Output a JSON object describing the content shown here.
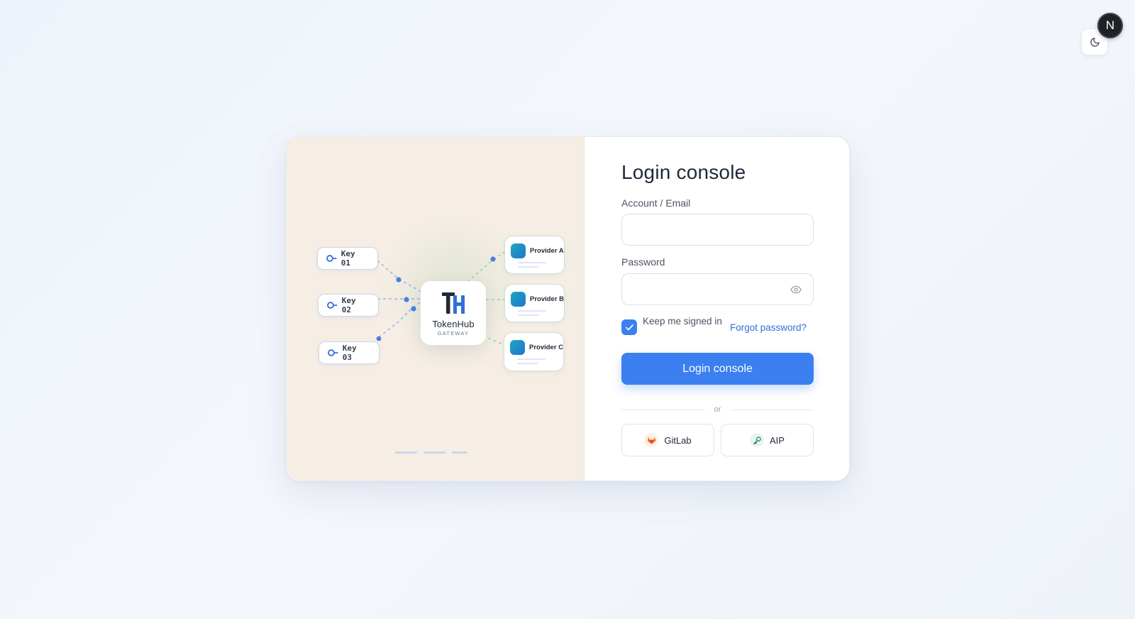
{
  "header": {
    "avatar_initial": "N",
    "theme_icon": "moon-icon"
  },
  "illustration": {
    "keys": [
      "Key 01",
      "Key 02",
      "Key 03"
    ],
    "hub": {
      "name": "TokenHub",
      "subtitle": "GATEWAY"
    },
    "providers": [
      "Provider A",
      "Provider B",
      "Provider C"
    ],
    "carousel_pages": 3,
    "carousel_active": 1
  },
  "form": {
    "title": "Login console",
    "account_label": "Account / Email",
    "account_value": "",
    "password_label": "Password",
    "password_value": "",
    "remember_label": "Keep me signed in",
    "remember_checked": true,
    "forgot_label": "Forgot password?",
    "submit_label": "Login console",
    "divider_text": "or",
    "sso": [
      {
        "label": "GitLab",
        "icon": "gitlab-icon"
      },
      {
        "label": "AIP",
        "icon": "key-icon"
      }
    ]
  },
  "colors": {
    "accent": "#3b7ff0",
    "panel_bg": "#f6eee5",
    "provider_border": "#c6e3d7",
    "gitlab": "#f26d22",
    "aip": "#1e8a5f"
  }
}
